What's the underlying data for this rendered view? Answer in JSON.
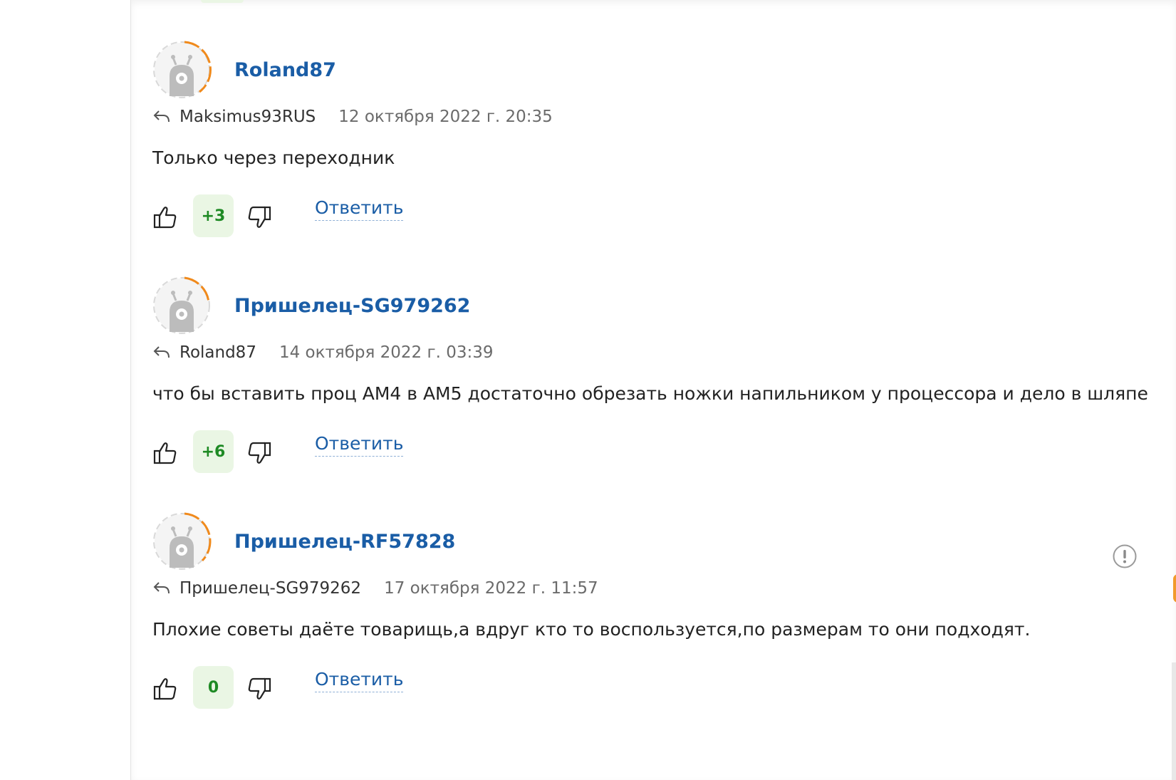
{
  "colors": {
    "username": "#1a5da6",
    "reply_link": "#1a5da6",
    "score_text": "#1e8a24",
    "score_bg": "#eaf6e4",
    "avatar_ring_accent": "#f08a1c"
  },
  "icons": {
    "avatar": "alien-avatar-icon",
    "reply_to": "reply-arrow-icon",
    "like": "thumbs-up-icon",
    "dislike": "thumbs-down-icon",
    "report": "exclamation-circle-icon"
  },
  "comments": [
    {
      "username": "Roland87",
      "reply_to": "Maksimus93RUS",
      "date": "12 октября 2022 г. 20:35",
      "text": "Только через переходник",
      "score": "+3",
      "reply_label": "Ответить"
    },
    {
      "username": "Пришелец-SG979262",
      "reply_to": "Roland87",
      "date": "14 октября 2022 г. 03:39",
      "text": "что бы вставить проц АМ4 в АМ5 достаточно обрезать ножки напильником у процессора и дело в шляпе",
      "score": "+6",
      "reply_label": "Ответить"
    },
    {
      "username": "Пришелец-RF57828",
      "reply_to": "Пришелец-SG979262",
      "date": "17 октября 2022 г. 11:57",
      "text": "Плохие советы даёте товарищь,а вдруг кто то воспользуется,по размерам то они подходят.",
      "score": "0",
      "reply_label": "Ответить"
    }
  ]
}
